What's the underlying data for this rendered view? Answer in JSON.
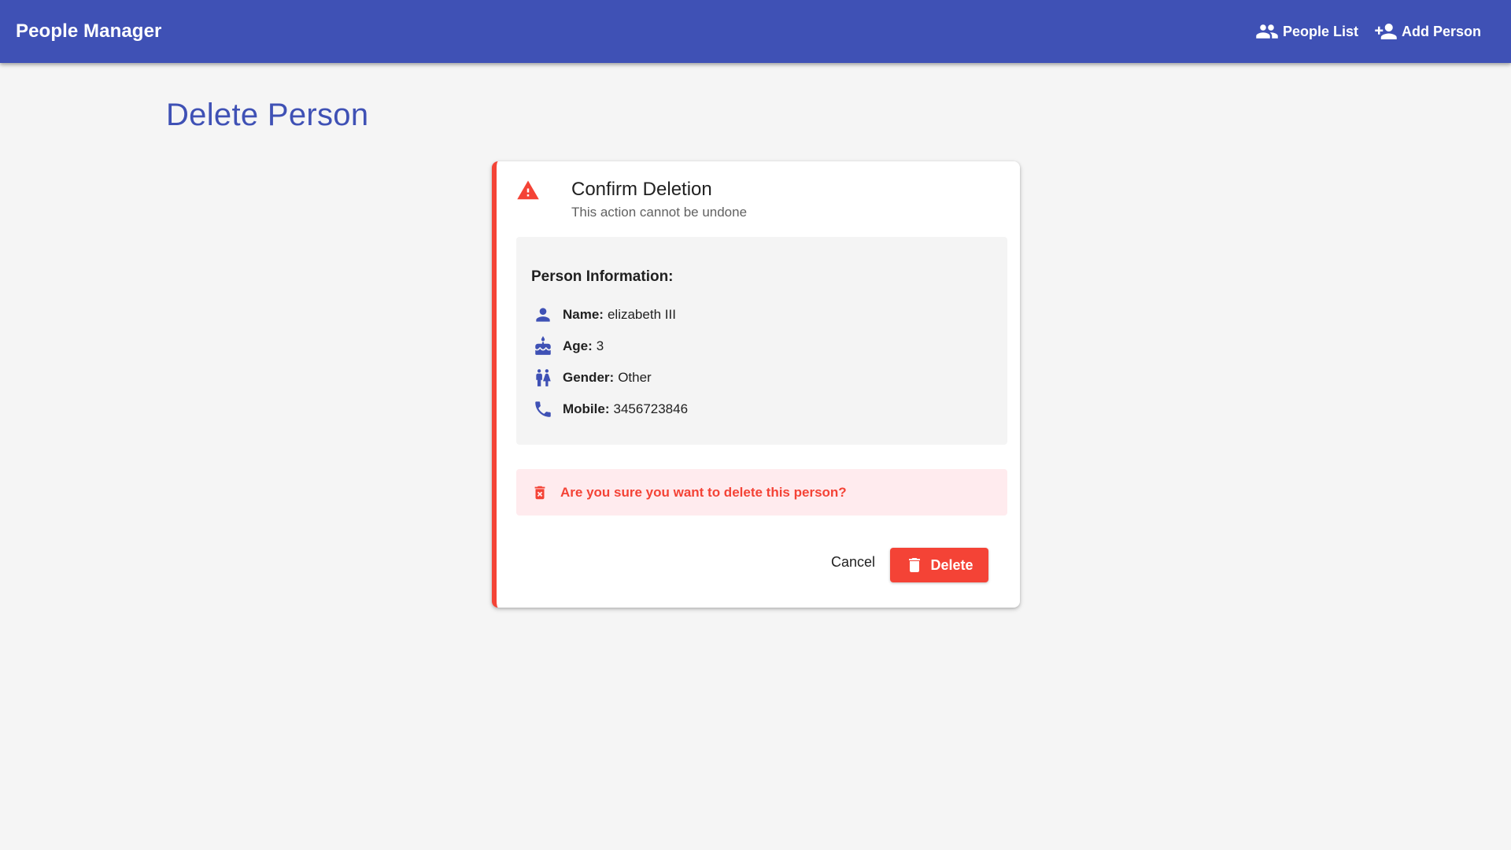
{
  "app": {
    "title": "People Manager"
  },
  "nav": {
    "items": [
      {
        "label": "People List",
        "icon": "people-icon"
      },
      {
        "label": "Add Person",
        "icon": "person-add-icon"
      }
    ]
  },
  "page": {
    "title": "Delete Person"
  },
  "card": {
    "icon": "warning-icon",
    "title": "Confirm Deletion",
    "subtitle": "This action cannot be undone",
    "info": {
      "heading": "Person Information:",
      "fields": [
        {
          "icon": "person-icon",
          "label": "Name:",
          "value": "elizabeth III"
        },
        {
          "icon": "cake-icon",
          "label": "Age:",
          "value": "3"
        },
        {
          "icon": "wc-icon",
          "label": "Gender:",
          "value": "Other"
        },
        {
          "icon": "phone-icon",
          "label": "Mobile:",
          "value": "3456723846"
        }
      ]
    },
    "alert": {
      "icon": "delete-forever-icon",
      "text": "Are you sure you want to delete this person?"
    },
    "actions": {
      "cancel_label": "Cancel",
      "delete_label": "Delete",
      "delete_icon": "trash-icon"
    }
  },
  "colors": {
    "primary": "#3f51b5",
    "warn": "#f44336",
    "alert_bg": "#ffebee",
    "info_bg": "#f4f4f4",
    "page_bg": "#f5f5f5"
  }
}
